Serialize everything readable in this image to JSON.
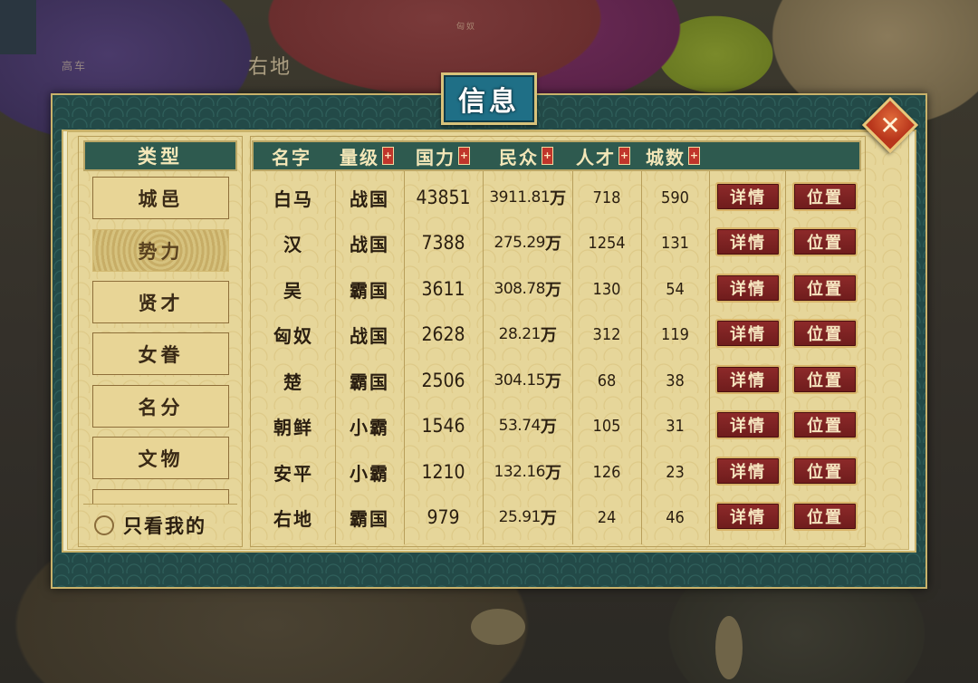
{
  "map": {
    "labels": [
      "右地",
      "高车",
      "匈奴"
    ]
  },
  "dialog": {
    "title": "信息",
    "close_label": "✕"
  },
  "sidebar": {
    "header": "类型",
    "items": [
      {
        "label": "城邑",
        "active": false
      },
      {
        "label": "势力",
        "active": true
      },
      {
        "label": "贤才",
        "active": false
      },
      {
        "label": "女眷",
        "active": false
      },
      {
        "label": "名分",
        "active": false
      },
      {
        "label": "文物",
        "active": false
      }
    ],
    "only_mine_label": "只看我的"
  },
  "table": {
    "columns": [
      {
        "label": "名字",
        "sortable": false
      },
      {
        "label": "量级",
        "sortable": true
      },
      {
        "label": "国力",
        "sortable": true
      },
      {
        "label": "民众",
        "sortable": true
      },
      {
        "label": "人才",
        "sortable": true
      },
      {
        "label": "城数",
        "sortable": true
      }
    ],
    "sort_symbol": "+",
    "detail_label": "详情",
    "locate_label": "位置",
    "rows": [
      {
        "name": "白马",
        "tier": "战国",
        "power": "43851",
        "pop_num": "3911.81",
        "pop_unit": "万",
        "talent": "718",
        "cities": "590"
      },
      {
        "name": "汉",
        "tier": "战国",
        "power": "7388",
        "pop_num": "275.29",
        "pop_unit": "万",
        "talent": "1254",
        "cities": "131"
      },
      {
        "name": "吴",
        "tier": "霸国",
        "power": "3611",
        "pop_num": "308.78",
        "pop_unit": "万",
        "talent": "130",
        "cities": "54"
      },
      {
        "name": "匈奴",
        "tier": "战国",
        "power": "2628",
        "pop_num": "28.21",
        "pop_unit": "万",
        "talent": "312",
        "cities": "119"
      },
      {
        "name": "楚",
        "tier": "霸国",
        "power": "2506",
        "pop_num": "304.15",
        "pop_unit": "万",
        "talent": "68",
        "cities": "38"
      },
      {
        "name": "朝鲜",
        "tier": "小霸",
        "power": "1546",
        "pop_num": "53.74",
        "pop_unit": "万",
        "talent": "105",
        "cities": "31"
      },
      {
        "name": "安平",
        "tier": "小霸",
        "power": "1210",
        "pop_num": "132.16",
        "pop_unit": "万",
        "talent": "126",
        "cities": "23"
      },
      {
        "name": "右地",
        "tier": "霸国",
        "power": "979",
        "pop_num": "25.91",
        "pop_unit": "万",
        "talent": "24",
        "cities": "46"
      }
    ]
  }
}
